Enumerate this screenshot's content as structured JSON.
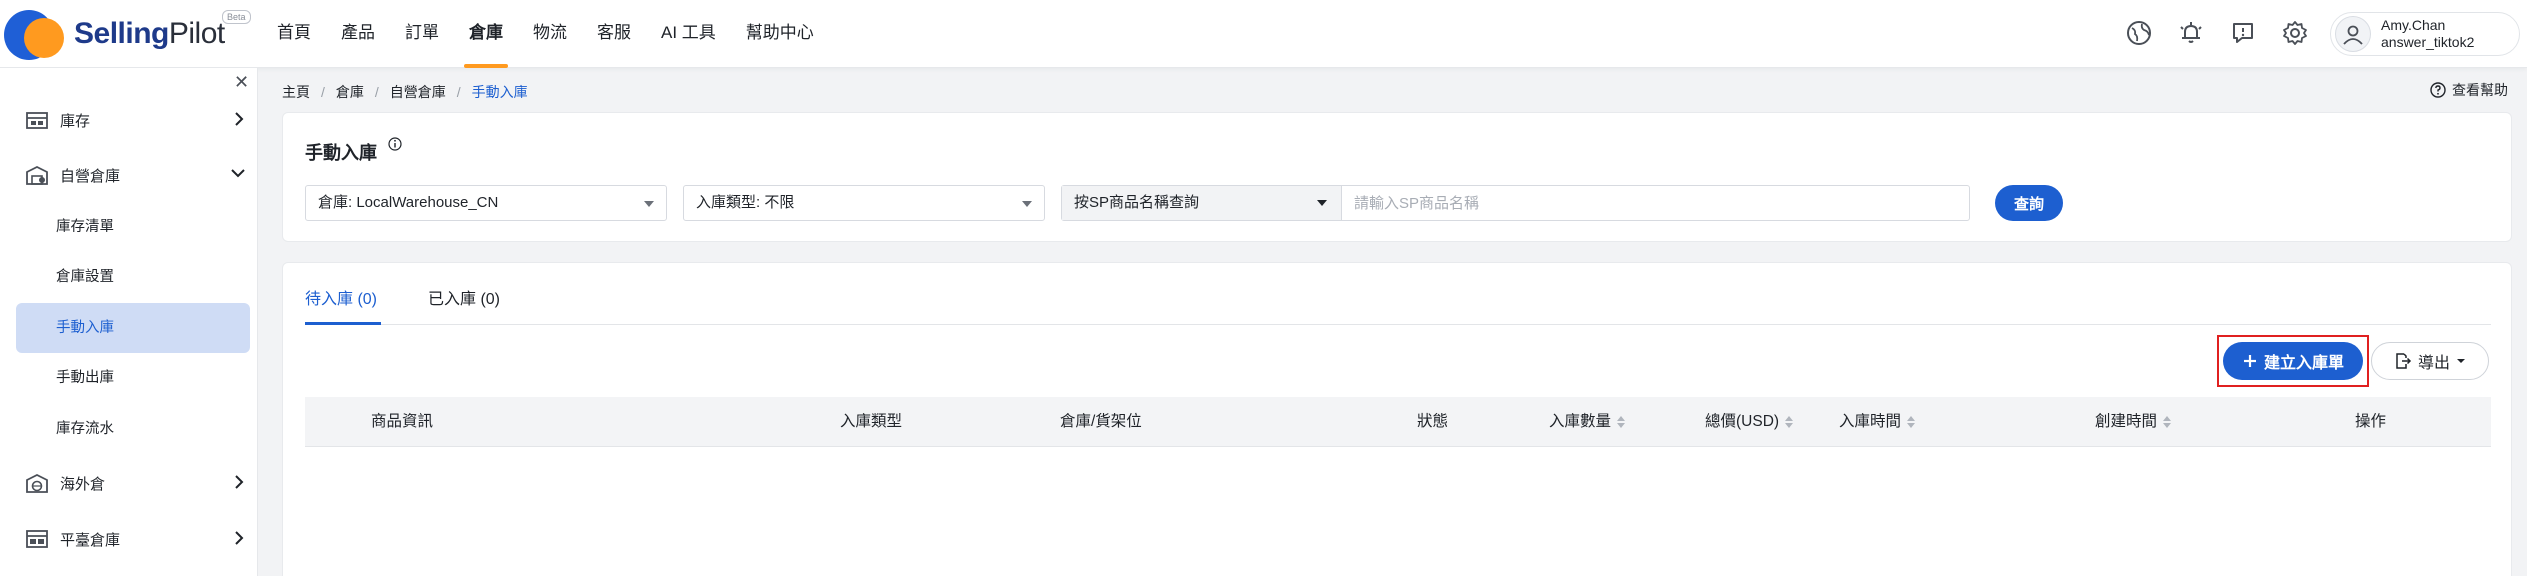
{
  "app": {
    "brand_bold": "Selling",
    "brand_thin": "Pilot",
    "badge": "Beta"
  },
  "topnav": [
    {
      "label": "首頁"
    },
    {
      "label": "產品"
    },
    {
      "label": "訂單"
    },
    {
      "label": "倉庫",
      "active": true
    },
    {
      "label": "物流"
    },
    {
      "label": "客服"
    },
    {
      "label": "AI 工具"
    },
    {
      "label": "幫助中心"
    }
  ],
  "top_icons": [
    "globe-icon",
    "bell-icon",
    "message-icon",
    "gear-icon"
  ],
  "user": {
    "name": "Amy.Chan",
    "account": "answer_tiktok2"
  },
  "sidebar": {
    "groups": [
      {
        "label": "庫存",
        "icon": "inventory-icon",
        "expanded": false
      },
      {
        "label": "自營倉庫",
        "icon": "warehouse-icon",
        "expanded": true,
        "items": [
          {
            "label": "庫存清單"
          },
          {
            "label": "倉庫設置"
          },
          {
            "label": "手動入庫",
            "active": true
          },
          {
            "label": "手動出庫"
          },
          {
            "label": "庫存流水"
          }
        ]
      },
      {
        "label": "海外倉",
        "icon": "overseas-warehouse-icon",
        "expanded": false
      },
      {
        "label": "平臺倉庫",
        "icon": "platform-warehouse-icon",
        "expanded": false
      }
    ]
  },
  "breadcrumb": [
    "主頁",
    "倉庫",
    "自營倉庫",
    "手動入庫"
  ],
  "help_label": "查看幫助",
  "filter": {
    "title": "手動入庫",
    "warehouse_select": "倉庫: LocalWarehouse_CN",
    "type_select": "入庫類型: 不限",
    "search_mode": "按SP商品名稱查詢",
    "search_placeholder": "請輸入SP商品名稱",
    "search_button": "查詢"
  },
  "tabs": [
    {
      "label": "待入庫 (0)",
      "active": true
    },
    {
      "label": "已入庫 (0)",
      "active": false
    }
  ],
  "actions": {
    "create": "建立入庫單",
    "export": "導出"
  },
  "table": {
    "columns": [
      "商品資訊",
      "入庫類型",
      "倉庫/貨架位",
      "狀態",
      "入庫數量",
      "總價(USD)",
      "入庫時間",
      "創建時間",
      "操作"
    ]
  },
  "colors": {
    "primary": "#1d5fd0",
    "accent": "#ff9a1f",
    "highlight_border": "#e02020"
  }
}
